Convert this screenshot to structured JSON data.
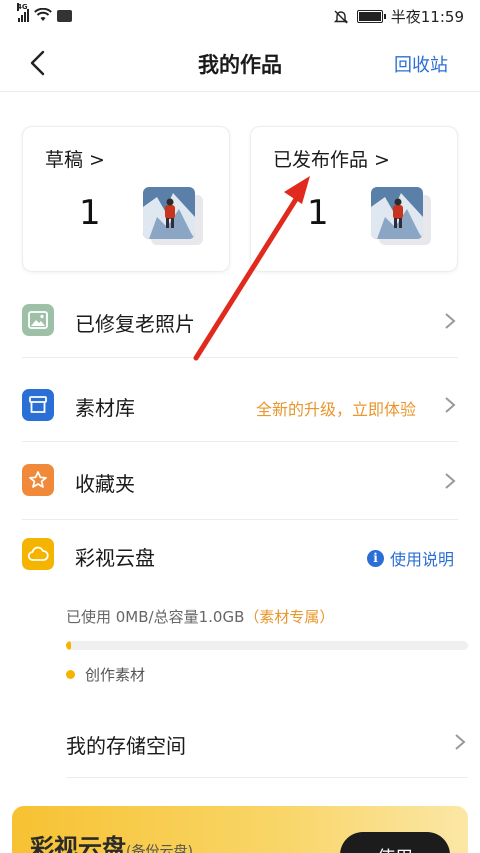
{
  "status_bar": {
    "network": "4G",
    "time": "半夜11:59",
    "icons": [
      "signal-icon",
      "wifi-icon",
      "huawei-badge-icon",
      "mute-bell-icon",
      "battery-icon"
    ]
  },
  "header": {
    "back_icon": "chevron-left-icon",
    "title": "我的作品",
    "recycle_label": "回收站"
  },
  "cards": [
    {
      "label": "草稿 >",
      "count": "1"
    },
    {
      "label": "已发布作品 >",
      "count": "1"
    }
  ],
  "list": [
    {
      "label": "已修复老照片",
      "icon": "photo-icon",
      "color": "#9fc0a8"
    },
    {
      "label": "素材库",
      "icon": "box-icon",
      "color": "#2a6fd6",
      "promo": "全新的升级，立即体验"
    },
    {
      "label": "收藏夹",
      "icon": "star-icon",
      "color": "#f08a3a"
    },
    {
      "label": "彩视云盘",
      "icon": "cloud-icon",
      "color": "#f5b400",
      "help": "使用说明"
    }
  ],
  "cloud": {
    "usage_text": "已使用 0MB/总容量1.0GB",
    "usage_tag": "（素材专属）",
    "progress_fraction": 0.01,
    "legend": "创作素材",
    "storage_label": "我的存储空间"
  },
  "banner": {
    "title": "彩视云盘",
    "subtitle": "(备份云盘)",
    "button": "使用"
  },
  "colors": {
    "accent_blue": "#2b6fd6",
    "promo_orange": "#e8962e",
    "cloud_yellow": "#f5b400",
    "annotation_red": "#e02a1e"
  }
}
